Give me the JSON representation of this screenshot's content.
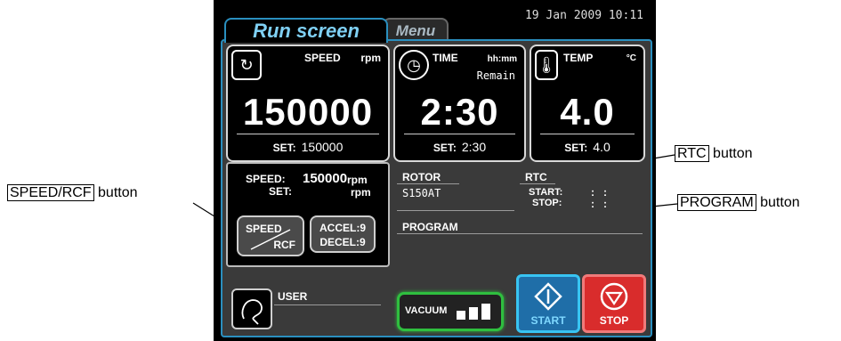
{
  "tabs": {
    "run": "Run screen",
    "menu": "Menu"
  },
  "datetime": "19 Jan 2009 10:11",
  "speed": {
    "title": "SPEED",
    "unit": "rpm",
    "value": "150000",
    "set_label": "SET:",
    "set_value": "150000"
  },
  "time": {
    "title": "TIME",
    "unit": "hh:mm",
    "sub": "Remain",
    "value": "2:30",
    "set_label": "SET:",
    "set_value": "2:30"
  },
  "temp": {
    "title": "TEMP",
    "unit": "°C",
    "value": "4.0",
    "set_label": "SET:",
    "set_value": "4.0"
  },
  "speed_info": {
    "speed_label": "SPEED:",
    "speed_value": "150000",
    "speed_unit": "rpm",
    "set_label": "SET:",
    "set_unit": "rpm"
  },
  "speed_rcf_button": {
    "top": "SPEED",
    "bottom": "RCF"
  },
  "accel_decel_button": {
    "accel": "ACCEL:9",
    "decel": "DECEL:9"
  },
  "rotor": {
    "title": "ROTOR",
    "value": "S150AT"
  },
  "rtc": {
    "title": "RTC",
    "start_label": "START:",
    "stop_label": "STOP:",
    "start_value": ":   :",
    "stop_value": ":   :"
  },
  "program": {
    "title": "PROGRAM"
  },
  "user": {
    "label": "USER"
  },
  "vacuum_button": {
    "label": "VACUUM"
  },
  "start_button": {
    "label": "START"
  },
  "stop_button": {
    "label": "STOP"
  },
  "callouts": {
    "speed_rcf": "SPEED/RCF",
    "speed_rcf_suffix": "button",
    "rtc": "RTC",
    "rtc_suffix": "button",
    "program": "PROGRAM",
    "program_suffix": "button"
  }
}
